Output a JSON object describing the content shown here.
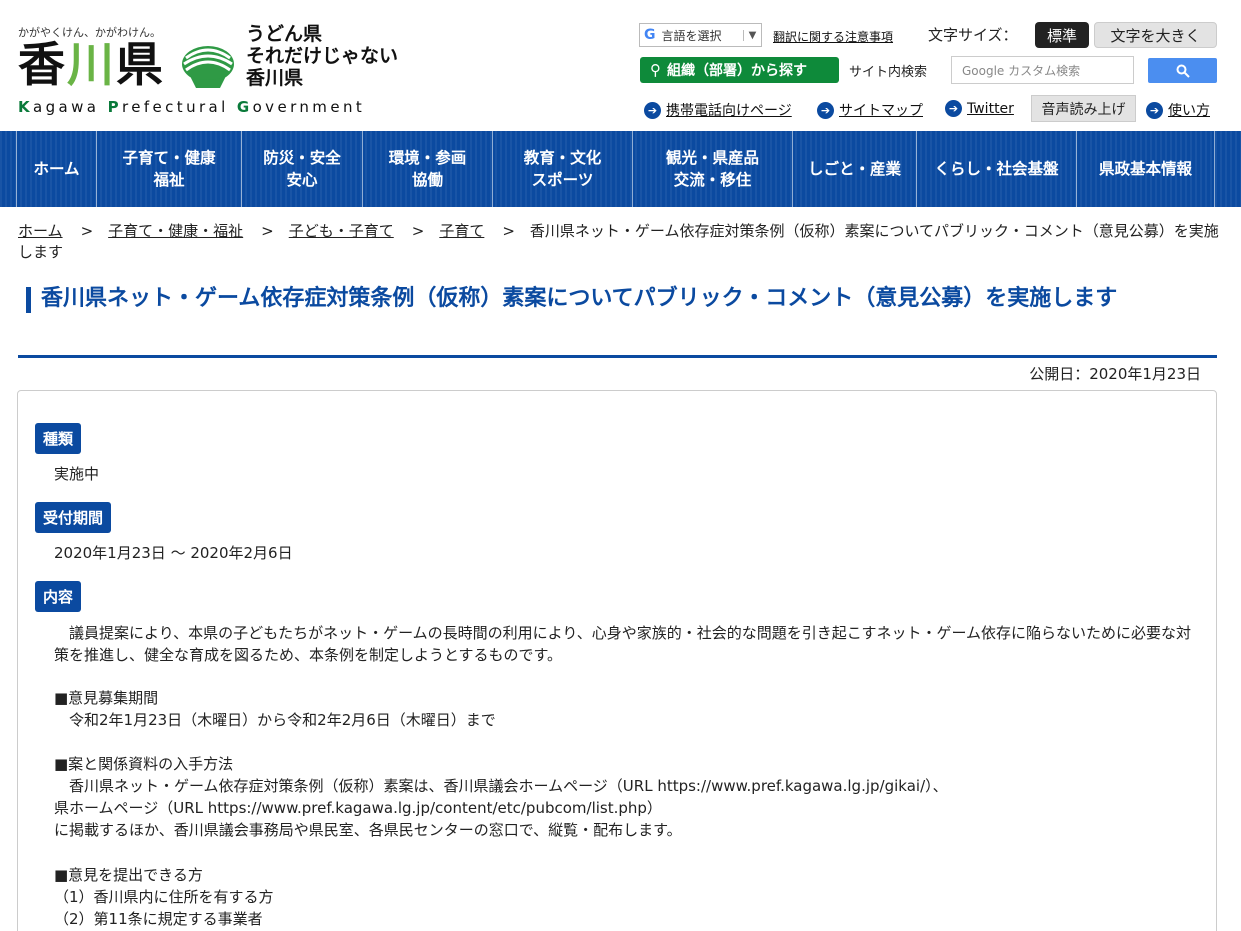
{
  "header": {
    "tagline": "かがやくけん、かがわけん。",
    "logo_kanji_a": "香",
    "logo_kanji_b": "川",
    "logo_kanji_c": "県",
    "slogan_line1": "うどん県",
    "slogan_line2": "それだけじゃない",
    "slogan_line3": "香川県",
    "logo_roman_k": "K",
    "logo_roman_1": "agawa ",
    "logo_roman_p": "P",
    "logo_roman_2": "refectural ",
    "logo_roman_g": "G",
    "logo_roman_3": "overnment",
    "translate_label": "言語を選択",
    "translate_g": "G",
    "translate_arrow": "▼",
    "translation_notice": "翻訳に関する注意事項",
    "font_size_label": "文字サイズ：",
    "font_standard": "標準",
    "font_large": "文字を大きく",
    "org_search": "組織（部署）から探す",
    "site_search_label": "サイト内検索",
    "search_placeholder": "Google カスタム検索",
    "search_icon": "🔍",
    "links": {
      "mobile": "携帯電話向けページ",
      "sitemap": "サイトマップ",
      "twitter": "Twitter",
      "voice": "音声読み上げ",
      "howto": "使い方"
    },
    "link_arrow": "➔"
  },
  "nav": {
    "items": [
      "ホーム",
      "子育て・健康\n福祉",
      "防災・安全\n安心",
      "環境・参画\n協働",
      "教育・文化\nスポーツ",
      "観光・県産品\n交流・移住",
      "しごと・産業",
      "くらし・社会基盤",
      "県政基本情報"
    ]
  },
  "breadcrumb": {
    "items": [
      "ホーム",
      "子育て・健康・福祉",
      "子ども・子育て",
      "子育て"
    ],
    "separator": ">",
    "current": "香川県ネット・ゲーム依存症対策条例（仮称）素案についてパブリック・コメント（意見公募）を実施します"
  },
  "page": {
    "title": "香川県ネット・ゲーム依存症対策条例（仮称）素案についてパブリック・コメント（意見公募）を実施します",
    "published": "公開日：2020年1月23日"
  },
  "content": {
    "type_label": "種類",
    "type_value": "実施中",
    "period_label": "受付期間",
    "period_value": "2020年1月23日 ～ 2020年2月6日",
    "detail_label": "内容",
    "detail_intro": "　議員提案により、本県の子どもたちがネット・ゲームの長時間の利用により、心身や家族的・社会的な問題を引き起こすネット・ゲーム依存に陥らないために必要な対策を推進し、健全な育成を図るため、本条例を制定しようとするものです。",
    "section1": "■意見募集期間\n　令和2年1月23日（木曜日）から令和2年2月6日（木曜日）まで",
    "section2": "■案と関係資料の入手方法\n　香川県ネット・ゲーム依存症対策条例（仮称）素案は、香川県議会ホームページ（URL https://www.pref.kagawa.lg.jp/gikai/）、\n県ホームページ（URL https://www.pref.kagawa.lg.jp/content/etc/pubcom/list.php）\nに掲載するほか、香川県議会事務局や県民室、各県民センターの窓口で、縦覧・配布します。",
    "section3": "■意見を提出できる方\n（1）香川県内に住所を有する方\n（2）第11条に規定する事業者"
  },
  "colors": {
    "brand_blue": "#0b4aa0",
    "green": "#0e8a3a"
  }
}
